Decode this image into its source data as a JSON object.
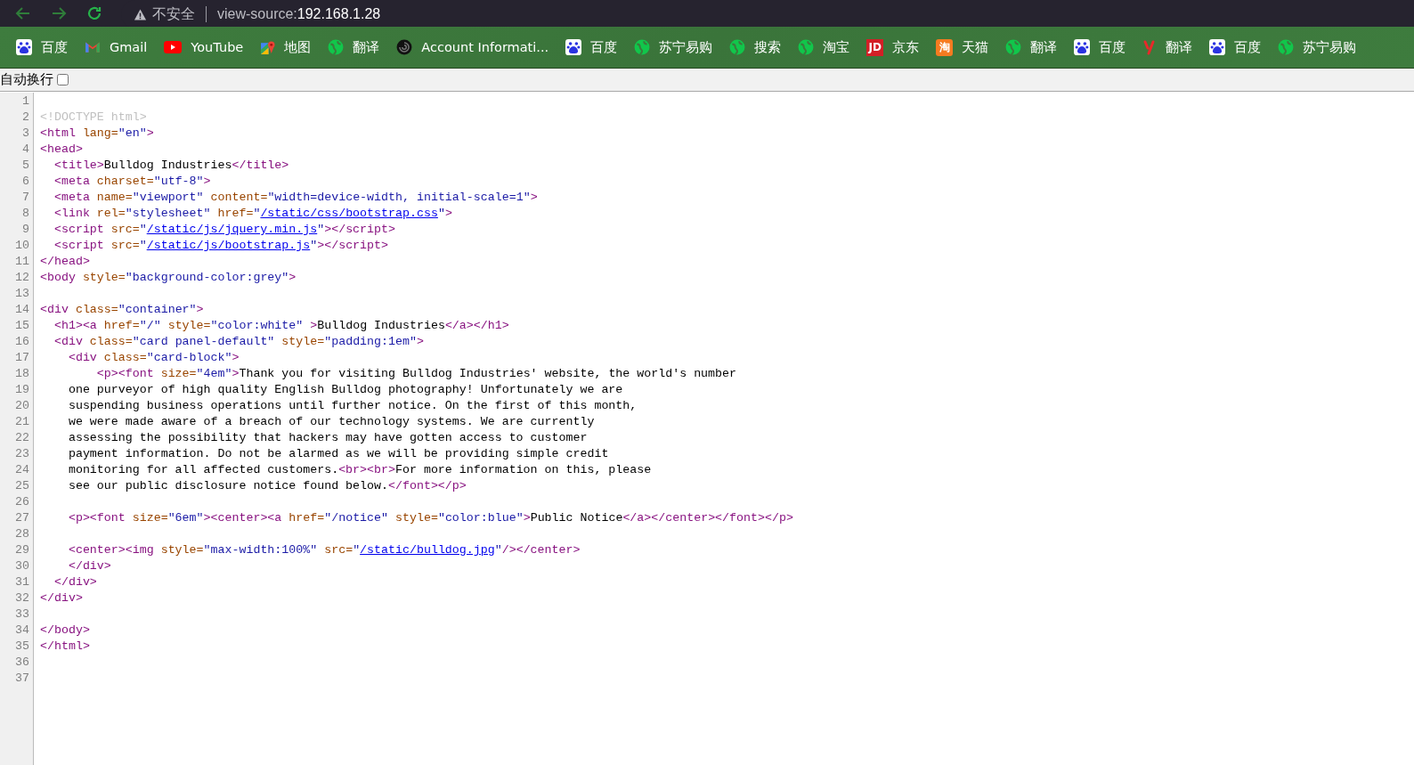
{
  "address_bar": {
    "security": "不安全",
    "scheme": "view-source:",
    "host": "192.168.1.28"
  },
  "bookmarks": [
    {
      "kind": "paw",
      "label": "百度"
    },
    {
      "kind": "mail",
      "label": "Gmail"
    },
    {
      "kind": "play",
      "label": "YouTube"
    },
    {
      "kind": "map",
      "label": "地图"
    },
    {
      "kind": "globe",
      "label": "翻译"
    },
    {
      "kind": "swirl",
      "label": "Account Informati..."
    },
    {
      "kind": "paw",
      "label": "百度"
    },
    {
      "kind": "globe",
      "label": "苏宁易购"
    },
    {
      "kind": "globe",
      "label": "搜索"
    },
    {
      "kind": "globe",
      "label": "淘宝"
    },
    {
      "kind": "jd",
      "label": "京东",
      "glyph": "JD"
    },
    {
      "kind": "tmall",
      "label": "天猫",
      "glyph": "淘"
    },
    {
      "kind": "globe",
      "label": "翻译"
    },
    {
      "kind": "paw",
      "label": "百度"
    },
    {
      "kind": "y",
      "label": "翻译"
    },
    {
      "kind": "paw",
      "label": "百度"
    },
    {
      "kind": "globe",
      "label": "苏宁易购"
    }
  ],
  "wrap_option": {
    "label": "自动换行",
    "checked": false
  },
  "source_lines": [
    {
      "number": "1"
    },
    {
      "number": "2",
      "segments": [
        {
          "kind": "doctype",
          "text": "<!DOCTYPE html>"
        }
      ]
    },
    {
      "number": "3",
      "segments": [
        {
          "kind": "tag",
          "text": "<html "
        },
        {
          "kind": "attr",
          "text": "lang="
        },
        {
          "kind": "value",
          "text": "\"en\""
        },
        {
          "kind": "tag",
          "text": ">"
        }
      ]
    },
    {
      "number": "4",
      "segments": [
        {
          "kind": "tag",
          "text": "<head>"
        }
      ]
    },
    {
      "number": "5",
      "segments": [
        {
          "kind": "tag",
          "text": "  <title>"
        },
        {
          "kind": "text",
          "text": "Bulldog Industries"
        },
        {
          "kind": "tag",
          "text": "</title>"
        }
      ]
    },
    {
      "number": "6",
      "segments": [
        {
          "kind": "tag",
          "text": "  <meta "
        },
        {
          "kind": "attr",
          "text": "charset="
        },
        {
          "kind": "value",
          "text": "\"utf-8\""
        },
        {
          "kind": "tag",
          "text": ">"
        }
      ]
    },
    {
      "number": "7",
      "segments": [
        {
          "kind": "tag",
          "text": "  <meta "
        },
        {
          "kind": "attr",
          "text": "name="
        },
        {
          "kind": "value",
          "text": "\"viewport\" "
        },
        {
          "kind": "attr",
          "text": "content="
        },
        {
          "kind": "value",
          "text": "\"width=device-width, initial-scale=1\""
        },
        {
          "kind": "tag",
          "text": ">"
        }
      ]
    },
    {
      "number": "8",
      "segments": [
        {
          "kind": "tag",
          "text": "  <link "
        },
        {
          "kind": "attr",
          "text": "rel="
        },
        {
          "kind": "value",
          "text": "\"stylesheet\" "
        },
        {
          "kind": "attr",
          "text": "href="
        },
        {
          "kind": "value",
          "text": "\""
        },
        {
          "kind": "link",
          "text": "/static/css/bootstrap.css"
        },
        {
          "kind": "value",
          "text": "\""
        },
        {
          "kind": "tag",
          "text": ">"
        }
      ]
    },
    {
      "number": "9",
      "segments": [
        {
          "kind": "tag",
          "text": "  <script "
        },
        {
          "kind": "attr",
          "text": "src="
        },
        {
          "kind": "value",
          "text": "\""
        },
        {
          "kind": "link",
          "text": "/static/js/jquery.min.js"
        },
        {
          "kind": "value",
          "text": "\""
        },
        {
          "kind": "tag",
          "text": "></script>"
        }
      ]
    },
    {
      "number": "10",
      "segments": [
        {
          "kind": "tag",
          "text": "  <script "
        },
        {
          "kind": "attr",
          "text": "src="
        },
        {
          "kind": "value",
          "text": "\""
        },
        {
          "kind": "link",
          "text": "/static/js/bootstrap.js"
        },
        {
          "kind": "value",
          "text": "\""
        },
        {
          "kind": "tag",
          "text": "></script>"
        }
      ]
    },
    {
      "number": "11",
      "segments": [
        {
          "kind": "tag",
          "text": "</head>"
        }
      ]
    },
    {
      "number": "12",
      "segments": [
        {
          "kind": "tag",
          "text": "<body "
        },
        {
          "kind": "attr",
          "text": "style="
        },
        {
          "kind": "value",
          "text": "\"background-color:grey\""
        },
        {
          "kind": "tag",
          "text": ">"
        }
      ]
    },
    {
      "number": "13"
    },
    {
      "number": "14",
      "segments": [
        {
          "kind": "tag",
          "text": "<div "
        },
        {
          "kind": "attr",
          "text": "class="
        },
        {
          "kind": "value",
          "text": "\"container\""
        },
        {
          "kind": "tag",
          "text": ">"
        }
      ]
    },
    {
      "number": "15",
      "segments": [
        {
          "kind": "tag",
          "text": "  <h1><a "
        },
        {
          "kind": "attr",
          "text": "href="
        },
        {
          "kind": "value",
          "text": "\"/\" "
        },
        {
          "kind": "attr",
          "text": "style="
        },
        {
          "kind": "value",
          "text": "\"color:white\" "
        },
        {
          "kind": "tag",
          "text": ">"
        },
        {
          "kind": "text",
          "text": "Bulldog Industries"
        },
        {
          "kind": "tag",
          "text": "</a></h1>"
        }
      ]
    },
    {
      "number": "16",
      "segments": [
        {
          "kind": "tag",
          "text": "  <div "
        },
        {
          "kind": "attr",
          "text": "class="
        },
        {
          "kind": "value",
          "text": "\"card panel-default\" "
        },
        {
          "kind": "attr",
          "text": "style="
        },
        {
          "kind": "value",
          "text": "\"padding:1em\""
        },
        {
          "kind": "tag",
          "text": ">"
        }
      ]
    },
    {
      "number": "17",
      "segments": [
        {
          "kind": "tag",
          "text": "    <div "
        },
        {
          "kind": "attr",
          "text": "class="
        },
        {
          "kind": "value",
          "text": "\"card-block\""
        },
        {
          "kind": "tag",
          "text": ">"
        }
      ]
    },
    {
      "number": "18",
      "segments": [
        {
          "kind": "tag",
          "text": "        <p><font "
        },
        {
          "kind": "attr",
          "text": "size="
        },
        {
          "kind": "value",
          "text": "\"4em\""
        },
        {
          "kind": "tag",
          "text": ">"
        },
        {
          "kind": "text",
          "text": "Thank you for visiting Bulldog Industries' website, the world's number"
        }
      ]
    },
    {
      "number": "19",
      "segments": [
        {
          "kind": "text",
          "text": "    one purveyor of high quality English Bulldog photography! Unfortunately we are"
        }
      ]
    },
    {
      "number": "20",
      "segments": [
        {
          "kind": "text",
          "text": "    suspending business operations until further notice. On the first of this month,"
        }
      ]
    },
    {
      "number": "21",
      "segments": [
        {
          "kind": "text",
          "text": "    we were made aware of a breach of our technology systems. We are currently"
        }
      ]
    },
    {
      "number": "22",
      "segments": [
        {
          "kind": "text",
          "text": "    assessing the possibility that hackers may have gotten access to customer"
        }
      ]
    },
    {
      "number": "23",
      "segments": [
        {
          "kind": "text",
          "text": "    payment information. Do not be alarmed as we will be providing simple credit"
        }
      ]
    },
    {
      "number": "24",
      "segments": [
        {
          "kind": "text",
          "text": "    monitoring for all affected customers."
        },
        {
          "kind": "tag",
          "text": "<br><br>"
        },
        {
          "kind": "text",
          "text": "For more information on this, please"
        }
      ]
    },
    {
      "number": "25",
      "segments": [
        {
          "kind": "text",
          "text": "    see our public disclosure notice found below."
        },
        {
          "kind": "tag",
          "text": "</font></p>"
        }
      ]
    },
    {
      "number": "26"
    },
    {
      "number": "27",
      "segments": [
        {
          "kind": "tag",
          "text": "    <p><font "
        },
        {
          "kind": "attr",
          "text": "size="
        },
        {
          "kind": "value",
          "text": "\"6em\""
        },
        {
          "kind": "tag",
          "text": "><center><a "
        },
        {
          "kind": "attr",
          "text": "href="
        },
        {
          "kind": "value",
          "text": "\"/notice\" "
        },
        {
          "kind": "attr",
          "text": "style="
        },
        {
          "kind": "value",
          "text": "\"color:blue\""
        },
        {
          "kind": "tag",
          "text": ">"
        },
        {
          "kind": "text",
          "text": "Public Notice"
        },
        {
          "kind": "tag",
          "text": "</a></center></font></p>"
        }
      ]
    },
    {
      "number": "28"
    },
    {
      "number": "29",
      "segments": [
        {
          "kind": "tag",
          "text": "    <center><img "
        },
        {
          "kind": "attr",
          "text": "style="
        },
        {
          "kind": "value",
          "text": "\"max-width:100%\" "
        },
        {
          "kind": "attr",
          "text": "src="
        },
        {
          "kind": "value",
          "text": "\""
        },
        {
          "kind": "link",
          "text": "/static/bulldog.jpg"
        },
        {
          "kind": "value",
          "text": "\""
        },
        {
          "kind": "tag",
          "text": "/></center>"
        }
      ]
    },
    {
      "number": "30",
      "segments": [
        {
          "kind": "tag",
          "text": "    </div>"
        }
      ]
    },
    {
      "number": "31",
      "segments": [
        {
          "kind": "tag",
          "text": "  </div>"
        }
      ]
    },
    {
      "number": "32",
      "segments": [
        {
          "kind": "tag",
          "text": "</div>"
        }
      ]
    },
    {
      "number": "33"
    },
    {
      "number": "34",
      "segments": [
        {
          "kind": "tag",
          "text": "</body>"
        }
      ]
    },
    {
      "number": "35",
      "segments": [
        {
          "kind": "tag",
          "text": "</html>"
        }
      ]
    },
    {
      "number": "36"
    },
    {
      "number": "37"
    }
  ]
}
